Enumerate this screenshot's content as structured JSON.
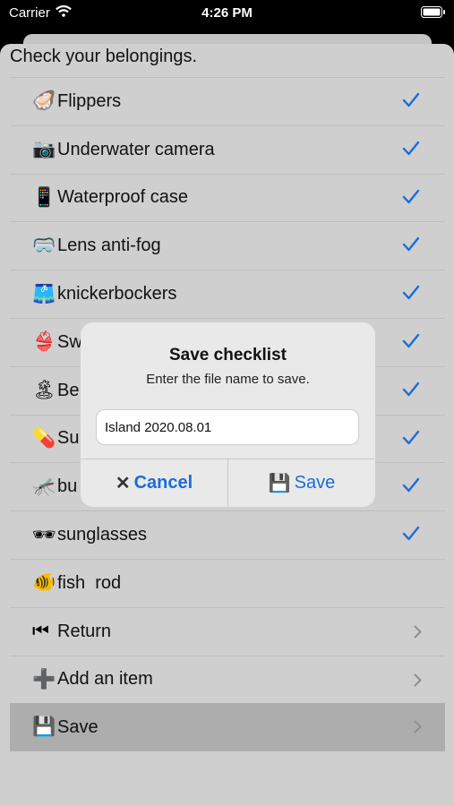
{
  "status_bar": {
    "carrier": "Carrier",
    "time": "4:26 PM"
  },
  "sheet": {
    "title": "Check your belongings."
  },
  "items": [
    {
      "emoji": "🦪",
      "label": "Flippers",
      "checked": true
    },
    {
      "emoji": "📷",
      "label": "Underwater camera",
      "checked": true
    },
    {
      "emoji": "📱",
      "label": "Waterproof case",
      "checked": true
    },
    {
      "emoji": "🥽",
      "label": "Lens anti-fog",
      "checked": true
    },
    {
      "emoji": "🩳",
      "label": "knickerbockers",
      "checked": true
    },
    {
      "emoji": "👙",
      "label": "Sw",
      "checked": true
    },
    {
      "emoji": "🏝",
      "label": "Be",
      "checked": true
    },
    {
      "emoji": "💊",
      "label": "Su",
      "checked": true
    },
    {
      "emoji": "🦟",
      "label": "bu",
      "checked": true
    },
    {
      "emoji": "🕶",
      "label": "sunglasses",
      "checked": true
    },
    {
      "emoji": "🐠",
      "label": "fish  rod",
      "checked": false
    }
  ],
  "actions": [
    {
      "emoji": "⏮",
      "label": "Return"
    },
    {
      "emoji": "➕",
      "label": "Add an item"
    },
    {
      "emoji": "💾",
      "label": "Save"
    }
  ],
  "dialog": {
    "title": "Save checklist",
    "message": "Enter the file name to save.",
    "input_value": "Island 2020.08.01",
    "cancel_label": "Cancel",
    "save_emoji": "💾",
    "save_label": "Save"
  },
  "colors": {
    "accent": "#1a6dd8",
    "sheet": "#cfcfcf",
    "selected_row": "#adadad"
  }
}
